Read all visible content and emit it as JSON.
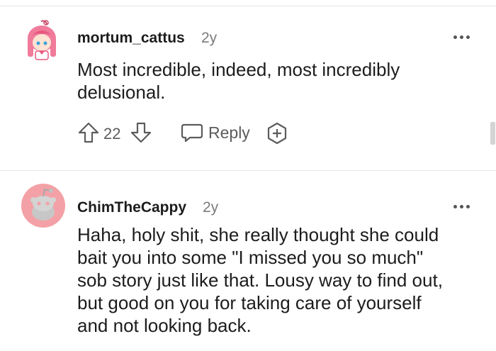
{
  "comments": [
    {
      "username": "mortum_cattus",
      "age": "2y",
      "body_lines": [
        "Most incredible, indeed, most incredibly",
        "delusional."
      ],
      "votes": "22",
      "reply_label": "Reply",
      "avatar_icon": "anime-avatar-icon"
    },
    {
      "username": "ChimTheCappy",
      "age": "2y",
      "body_lines": [
        "Haha, holy shit, she really thought she could",
        "bait you into some \"I missed you so much\"",
        "sob story just like that. Lousy way to find out,",
        "but good on you for taking care of yourself",
        "and not looking back."
      ],
      "avatar_icon": "snoo-avatar-icon"
    }
  ],
  "colors": {
    "text": "#1c1c1c",
    "muted": "#7c7c7c",
    "icon": "#5c5c5c",
    "avatar_bg_2": "#f3a1a6",
    "divider": "#e6e6e6"
  }
}
